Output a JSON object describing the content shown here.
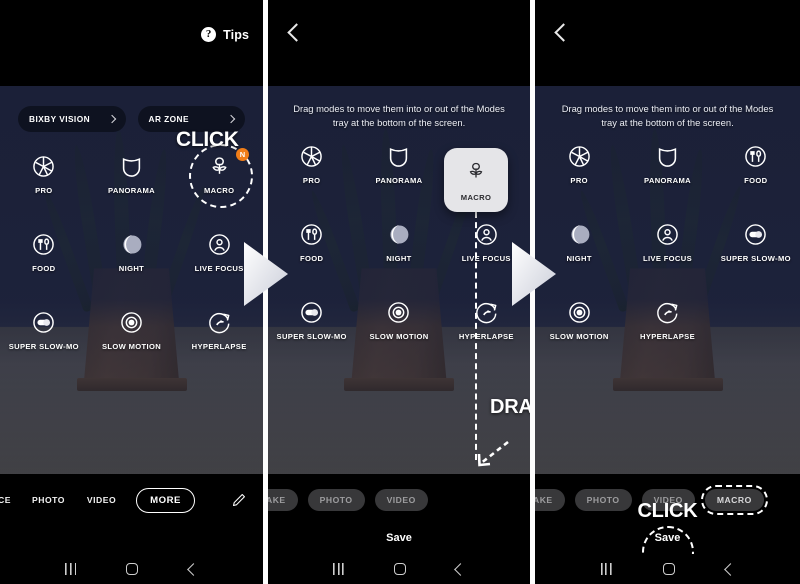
{
  "meta": {
    "title": "Samsung Camera — add Macro mode to Modes tray (3-step tutorial)",
    "accent_badge_color": "#f07d18",
    "highlight_color": "#ffffff",
    "panel_bg": "#000000"
  },
  "panels": [
    {
      "id": "step-1",
      "header": {
        "tips_label": "Tips",
        "tips_icon": "question-circle-icon"
      },
      "quick_pills": [
        {
          "label": "BIXBY VISION",
          "chevron": "chevron-right-icon"
        },
        {
          "label": "AR ZONE",
          "chevron": "chevron-right-icon"
        }
      ],
      "modes": [
        {
          "label": "PRO",
          "icon": "aperture-icon"
        },
        {
          "label": "PANORAMA",
          "icon": "panorama-icon"
        },
        {
          "label": "MACRO",
          "icon": "flower-icon",
          "badge": "N",
          "highlight": "click-ring"
        },
        {
          "label": "FOOD",
          "icon": "fork-spoon-icon"
        },
        {
          "label": "NIGHT",
          "icon": "moon-icon"
        },
        {
          "label": "LIVE FOCUS",
          "icon": "portrait-icon"
        },
        {
          "label": "SUPER SLOW-MO",
          "icon": "super-slow-mo-icon"
        },
        {
          "label": "SLOW MOTION",
          "icon": "slow-motion-icon"
        },
        {
          "label": "HYPERLAPSE",
          "icon": "hyperlapse-icon"
        }
      ],
      "annotation": {
        "click_label": "CLICK"
      },
      "tray": {
        "style": "text",
        "items": [
          {
            "label": "CE",
            "state": "cut-off"
          },
          {
            "label": "PHOTO",
            "state": "dim"
          },
          {
            "label": "VIDEO",
            "state": "dim"
          },
          {
            "label": "MORE",
            "state": "selected"
          }
        ],
        "edit_icon": "pencil-icon"
      },
      "navbar": {
        "recents": "recents-icon",
        "home": "home-icon",
        "back": "back-icon"
      }
    },
    {
      "id": "step-2",
      "header": {
        "back_icon": "back-chevron-icon"
      },
      "instruction": "Drag modes to move them into or out of the Modes tray at the bottom of the screen.",
      "modes": [
        {
          "label": "PRO",
          "icon": "aperture-icon"
        },
        {
          "label": "PANORAMA",
          "icon": "panorama-icon"
        },
        {
          "label": "MACRO",
          "icon": "flower-icon",
          "highlight": "lifted-tile"
        },
        {
          "label": "FOOD",
          "icon": "fork-spoon-icon"
        },
        {
          "label": "NIGHT",
          "icon": "moon-icon"
        },
        {
          "label": "LIVE FOCUS",
          "icon": "portrait-icon"
        },
        {
          "label": "SUPER SLOW-MO",
          "icon": "super-slow-mo-icon"
        },
        {
          "label": "SLOW MOTION",
          "icon": "slow-motion-icon"
        },
        {
          "label": "HYPERLAPSE",
          "icon": "hyperlapse-icon"
        }
      ],
      "annotation": {
        "drag_label": "DRAG"
      },
      "tray": {
        "style": "chips",
        "items": [
          {
            "label": "AKE",
            "state": "cut-off"
          },
          {
            "label": "PHOTO",
            "state": "dim"
          },
          {
            "label": "VIDEO",
            "state": "dim"
          }
        ]
      },
      "save_label": "Save",
      "navbar": {
        "recents": "recents-icon",
        "home": "home-icon",
        "back": "back-icon"
      }
    },
    {
      "id": "step-3",
      "header": {
        "back_icon": "back-chevron-icon"
      },
      "instruction": "Drag modes to move them into or out of the Modes tray at the bottom of the screen.",
      "modes": [
        {
          "label": "PRO",
          "icon": "aperture-icon"
        },
        {
          "label": "PANORAMA",
          "icon": "panorama-icon"
        },
        {
          "label": "FOOD",
          "icon": "fork-spoon-icon"
        },
        {
          "label": "NIGHT",
          "icon": "moon-icon"
        },
        {
          "label": "LIVE FOCUS",
          "icon": "portrait-icon"
        },
        {
          "label": "SUPER SLOW-MO",
          "icon": "super-slow-mo-icon"
        },
        {
          "label": "SLOW MOTION",
          "icon": "slow-motion-icon"
        },
        {
          "label": "HYPERLAPSE",
          "icon": "hyperlapse-icon"
        }
      ],
      "annotation": {
        "click_label": "CLICK"
      },
      "tray": {
        "style": "chips",
        "items": [
          {
            "label": "AKE",
            "state": "cut-off"
          },
          {
            "label": "PHOTO",
            "state": "dim"
          },
          {
            "label": "VIDEO",
            "state": "dim"
          },
          {
            "label": "MACRO",
            "state": "added-highlight"
          }
        ]
      },
      "save_label": "Save",
      "navbar": {
        "recents": "recents-icon",
        "home": "home-icon",
        "back": "back-icon"
      }
    }
  ],
  "separators": [
    {
      "icon": "arrow-right-triangle-icon"
    },
    {
      "icon": "arrow-right-triangle-icon"
    }
  ]
}
